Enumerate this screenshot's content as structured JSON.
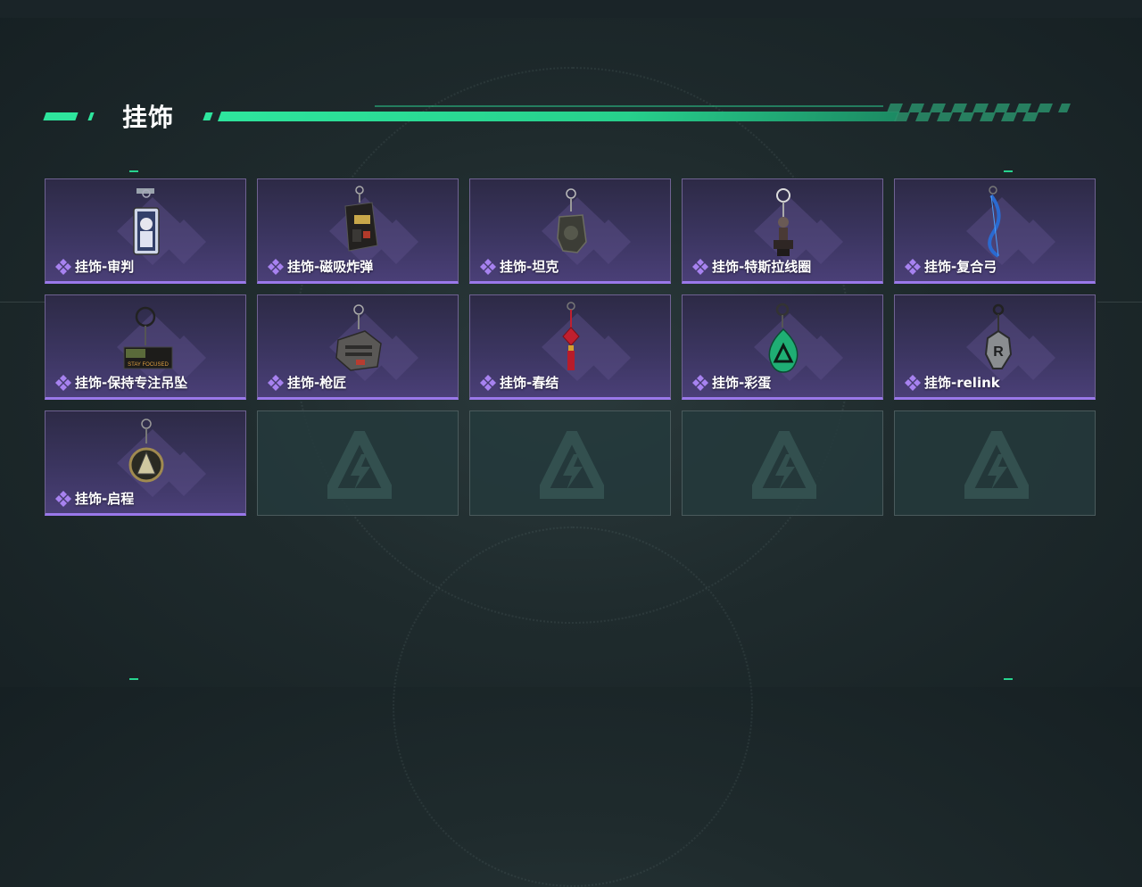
{
  "header": {
    "title": "挂饰"
  },
  "colors": {
    "accent": "#2ee59d",
    "rarity": "#9a78ea",
    "card_bg": "#3b3560"
  },
  "items": [
    {
      "label": "挂饰-审判",
      "icon": "judgment-charm-icon",
      "filled": true
    },
    {
      "label": "挂饰-磁吸炸弹",
      "icon": "magnetic-bomb-charm-icon",
      "filled": true
    },
    {
      "label": "挂饰-坦克",
      "icon": "tank-charm-icon",
      "filled": true
    },
    {
      "label": "挂饰-特斯拉线圈",
      "icon": "tesla-coil-charm-icon",
      "filled": true
    },
    {
      "label": "挂饰-复合弓",
      "icon": "compound-bow-charm-icon",
      "filled": true
    },
    {
      "label": "挂饰-保持专注吊坠",
      "icon": "stay-focused-charm-icon",
      "filled": true
    },
    {
      "label": "挂饰-枪匠",
      "icon": "gunsmith-charm-icon",
      "filled": true
    },
    {
      "label": "挂饰-春结",
      "icon": "chinese-knot-charm-icon",
      "filled": true
    },
    {
      "label": "挂饰-彩蛋",
      "icon": "easter-egg-charm-icon",
      "filled": true
    },
    {
      "label": "挂饰-relink",
      "icon": "relink-charm-icon",
      "filled": true
    },
    {
      "label": "挂饰-启程",
      "icon": "departure-charm-icon",
      "filled": true
    },
    {
      "label": "",
      "icon": "empty-slot-logo-icon",
      "filled": false
    },
    {
      "label": "",
      "icon": "empty-slot-logo-icon",
      "filled": false
    },
    {
      "label": "",
      "icon": "empty-slot-logo-icon",
      "filled": false
    },
    {
      "label": "",
      "icon": "empty-slot-logo-icon",
      "filled": false
    }
  ],
  "card_texts": {
    "stay_focused_tag": "STAY FOCUSED"
  }
}
